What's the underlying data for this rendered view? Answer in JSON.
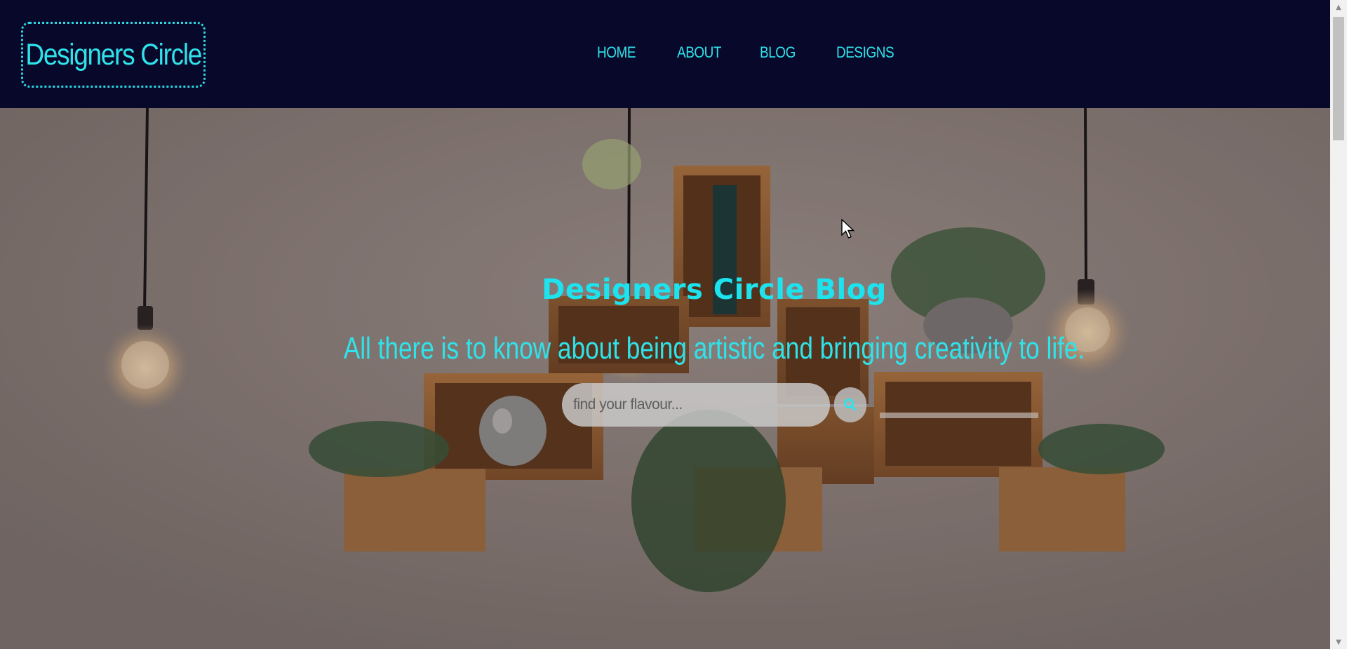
{
  "navbar": {
    "logo": "Designers Circle",
    "links": [
      "HOME",
      "ABOUT",
      "BLOG",
      "DESIGNS"
    ]
  },
  "hero": {
    "title": "Designers Circle Blog",
    "subtitle": "All there is to know about being artistic and bringing creativity to life.",
    "search": {
      "placeholder": "find your flavour...",
      "button_icon": "search-icon"
    },
    "background_icon": "shelves-photo"
  },
  "colors": {
    "navbar_bg": "#08082b",
    "accent": "#2fe3ea"
  },
  "scrollbar": {
    "up_icon": "▲",
    "down_icon": "▼"
  }
}
